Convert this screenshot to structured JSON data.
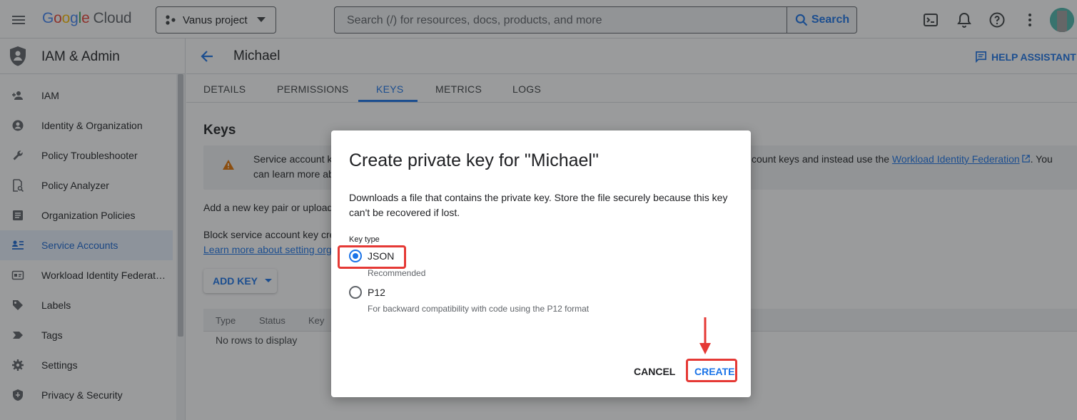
{
  "topbar": {
    "logo_letters": [
      "G",
      "o",
      "o",
      "g",
      "l",
      "e"
    ],
    "logo_cloud": "Cloud",
    "project": "Vanus project",
    "search_placeholder": "Search (/) for resources, docs, products, and more",
    "search_button": "Search"
  },
  "sidebar": {
    "title": "IAM & Admin",
    "items": [
      {
        "label": "IAM",
        "icon": "person-add-icon"
      },
      {
        "label": "Identity & Organization",
        "icon": "account-circle-icon"
      },
      {
        "label": "Policy Troubleshooter",
        "icon": "wrench-icon"
      },
      {
        "label": "Policy Analyzer",
        "icon": "document-search-icon"
      },
      {
        "label": "Organization Policies",
        "icon": "list-doc-icon"
      },
      {
        "label": "Service Accounts",
        "icon": "service-account-icon",
        "active": true
      },
      {
        "label": "Workload Identity Federat…",
        "icon": "id-card-icon"
      },
      {
        "label": "Labels",
        "icon": "label-tag-icon"
      },
      {
        "label": "Tags",
        "icon": "tag-arrow-icon"
      },
      {
        "label": "Settings",
        "icon": "gear-icon"
      },
      {
        "label": "Privacy & Security",
        "icon": "shield-icon"
      }
    ]
  },
  "page": {
    "title": "Michael",
    "help_assistant": "HELP ASSISTANT",
    "tabs": [
      "DETAILS",
      "PERMISSIONS",
      "KEYS",
      "METRICS",
      "LOGS"
    ],
    "active_tab": "KEYS",
    "keys_heading": "Keys",
    "warning_line1": "Service account ke",
    "warning_line2": "can learn more ab",
    "warning_right": "count keys and instead use the",
    "warning_link": "Workload Identity Federation",
    "warning_tail": ". You",
    "add_text": "Add a new key pair or upload a",
    "block_text": "Block service account key cre",
    "learn_link": "Learn more about setting orgs",
    "add_key_button": "ADD KEY",
    "table_columns": [
      "Type",
      "Status",
      "Key"
    ],
    "no_rows": "No rows to display"
  },
  "dialog": {
    "title": "Create private key for \"Michael\"",
    "description": "Downloads a file that contains the private key. Store the file securely because this key can't be recovered if lost.",
    "key_type_label": "Key type",
    "options": [
      {
        "label": "JSON",
        "sub": "Recommended",
        "checked": true
      },
      {
        "label": "P12",
        "sub": "For backward compatibility with code using the P12 format",
        "checked": false
      }
    ],
    "cancel": "CANCEL",
    "create": "CREATE"
  },
  "colors": {
    "accent": "#1a73e8",
    "highlight": "#e53935"
  }
}
